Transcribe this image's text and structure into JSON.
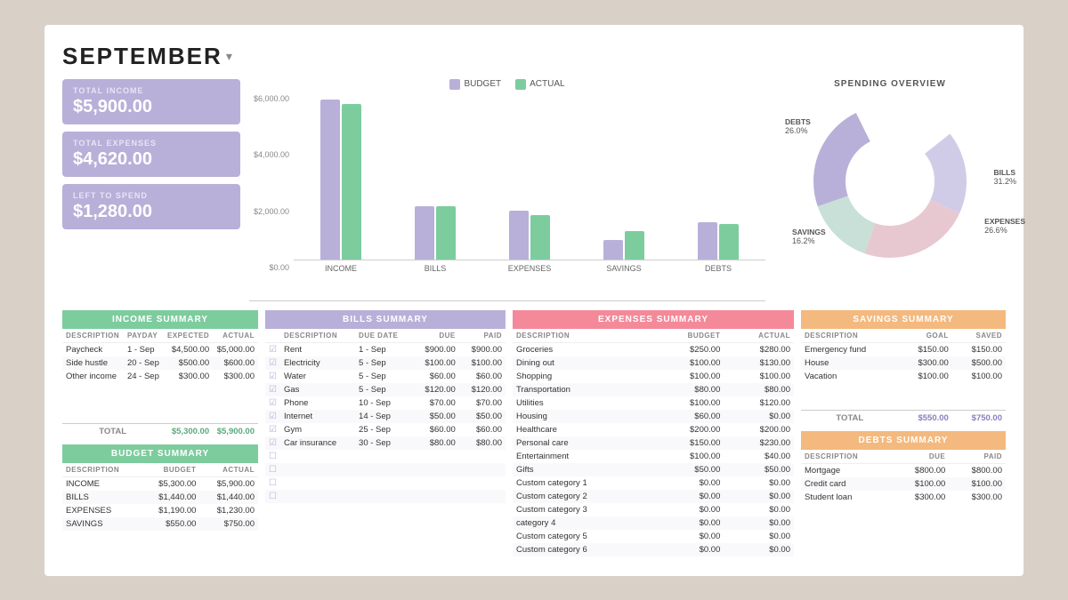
{
  "header": {
    "month": "SEPTEMBER",
    "dropdown": "▾"
  },
  "kpis": [
    {
      "label": "TOTAL INCOME",
      "value": "$5,900.00"
    },
    {
      "label": "TOTAL EXPENSES",
      "value": "$4,620.00"
    },
    {
      "label": "LEFT TO SPEND",
      "value": "$1,280.00"
    }
  ],
  "chart": {
    "legend": [
      "BUDGET",
      "ACTUAL"
    ],
    "yLabels": [
      "$6,000.00",
      "$4,000.00",
      "$2,000.00",
      "$0.00"
    ],
    "groups": [
      {
        "label": "INCOME",
        "budget": 180,
        "actual": 175
      },
      {
        "label": "BILLS",
        "budget": 60,
        "actual": 60
      },
      {
        "label": "EXPENSES",
        "budget": 55,
        "actual": 50
      },
      {
        "label": "SAVINGS",
        "budget": 22,
        "actual": 32
      },
      {
        "label": "DEBTS",
        "budget": 42,
        "actual": 40
      }
    ]
  },
  "donut": {
    "title": "SPENDING OVERVIEW",
    "segments": [
      {
        "label": "BILLS",
        "pct": "31.2%",
        "color": "#d0cce8"
      },
      {
        "label": "EXPENSES",
        "pct": "26.6%",
        "color": "#e8c8d0"
      },
      {
        "label": "SAVINGS",
        "pct": "16.2%",
        "color": "#c8d8e8"
      },
      {
        "label": "DEBTS",
        "pct": "26.0%",
        "color": "#b8b0d8"
      }
    ]
  },
  "income": {
    "header": "INCOME SUMMARY",
    "columns": [
      "DESCRIPTION",
      "PAYDAY",
      "EXPECTED",
      "ACTUAL"
    ],
    "rows": [
      {
        "desc": "Paycheck",
        "payday": "1 - Sep",
        "expected": "$4,500.00",
        "actual": "$5,000.00"
      },
      {
        "desc": "Side hustle",
        "payday": "20 - Sep",
        "expected": "$500.00",
        "actual": "$600.00"
      },
      {
        "desc": "Other income",
        "payday": "24 - Sep",
        "expected": "$300.00",
        "actual": "$300.00"
      }
    ],
    "total": {
      "label": "TOTAL",
      "expected": "$5,300.00",
      "actual": "$5,900.00"
    }
  },
  "budget": {
    "header": "BUDGET SUMMARY",
    "columns": [
      "DESCRIPTION",
      "BUDGET",
      "ACTUAL"
    ],
    "rows": [
      {
        "desc": "INCOME",
        "budget": "$5,300.00",
        "actual": "$5,900.00"
      },
      {
        "desc": "BILLS",
        "budget": "$1,440.00",
        "actual": "$1,440.00"
      },
      {
        "desc": "EXPENSES",
        "budget": "$1,190.00",
        "actual": "$1,230.00"
      },
      {
        "desc": "SAVINGS",
        "budget": "$550.00",
        "actual": "$750.00"
      }
    ]
  },
  "bills": {
    "header": "BILLS SUMMARY",
    "columns": [
      "DESCRIPTION",
      "DUE DATE",
      "DUE",
      "PAID"
    ],
    "rows": [
      {
        "checked": true,
        "desc": "Rent",
        "due_date": "1 - Sep",
        "due": "$900.00",
        "paid": "$900.00"
      },
      {
        "checked": true,
        "desc": "Electricity",
        "due_date": "5 - Sep",
        "due": "$100.00",
        "paid": "$100.00"
      },
      {
        "checked": true,
        "desc": "Water",
        "due_date": "5 - Sep",
        "due": "$60.00",
        "paid": "$60.00"
      },
      {
        "checked": true,
        "desc": "Gas",
        "due_date": "5 - Sep",
        "due": "$120.00",
        "paid": "$120.00"
      },
      {
        "checked": true,
        "desc": "Phone",
        "due_date": "10 - Sep",
        "due": "$70.00",
        "paid": "$70.00"
      },
      {
        "checked": true,
        "desc": "Internet",
        "due_date": "14 - Sep",
        "due": "$50.00",
        "paid": "$50.00"
      },
      {
        "checked": true,
        "desc": "Gym",
        "due_date": "25 - Sep",
        "due": "$60.00",
        "paid": "$60.00"
      },
      {
        "checked": true,
        "desc": "Car insurance",
        "due_date": "30 - Sep",
        "due": "$80.00",
        "paid": "$80.00"
      },
      {
        "checked": false,
        "desc": "",
        "due_date": "",
        "due": "",
        "paid": ""
      },
      {
        "checked": false,
        "desc": "",
        "due_date": "",
        "due": "",
        "paid": ""
      },
      {
        "checked": false,
        "desc": "",
        "due_date": "",
        "due": "",
        "paid": ""
      },
      {
        "checked": false,
        "desc": "",
        "due_date": "",
        "due": "",
        "paid": ""
      }
    ]
  },
  "expenses": {
    "header": "EXPENSES SUMMARY",
    "columns": [
      "DESCRIPTION",
      "BUDGET",
      "ACTUAL"
    ],
    "rows": [
      {
        "desc": "Groceries",
        "budget": "$250.00",
        "actual": "$280.00"
      },
      {
        "desc": "Dining out",
        "budget": "$100.00",
        "actual": "$130.00"
      },
      {
        "desc": "Shopping",
        "budget": "$100.00",
        "actual": "$100.00"
      },
      {
        "desc": "Transportation",
        "budget": "$80.00",
        "actual": "$80.00"
      },
      {
        "desc": "Utilities",
        "budget": "$100.00",
        "actual": "$120.00"
      },
      {
        "desc": "Housing",
        "budget": "$60.00",
        "actual": "$0.00"
      },
      {
        "desc": "Healthcare",
        "budget": "$200.00",
        "actual": "$200.00"
      },
      {
        "desc": "Personal care",
        "budget": "$150.00",
        "actual": "$230.00"
      },
      {
        "desc": "Entertainment",
        "budget": "$100.00",
        "actual": "$40.00"
      },
      {
        "desc": "Gifts",
        "budget": "$50.00",
        "actual": "$50.00"
      },
      {
        "desc": "Custom category 1",
        "budget": "$0.00",
        "actual": "$0.00"
      },
      {
        "desc": "Custom category 2",
        "budget": "$0.00",
        "actual": "$0.00"
      },
      {
        "desc": "Custom category 3",
        "budget": "$0.00",
        "actual": "$0.00"
      },
      {
        "desc": "category 4",
        "budget": "$0.00",
        "actual": "$0.00"
      },
      {
        "desc": "Custom category 5",
        "budget": "$0.00",
        "actual": "$0.00"
      },
      {
        "desc": "Custom category 6",
        "budget": "$0.00",
        "actual": "$0.00"
      }
    ]
  },
  "savings": {
    "header": "SAVINGS SUMMARY",
    "columns": [
      "DESCRIPTION",
      "GOAL",
      "SAVED"
    ],
    "rows": [
      {
        "desc": "Emergency fund",
        "goal": "$150.00",
        "saved": "$150.00"
      },
      {
        "desc": "House",
        "goal": "$300.00",
        "saved": "$500.00"
      },
      {
        "desc": "Vacation",
        "goal": "$100.00",
        "saved": "$100.00"
      }
    ],
    "total": {
      "label": "TOTAL",
      "goal": "$550.00",
      "saved": "$750.00"
    }
  },
  "debts": {
    "header": "DEBTS SUMMARY",
    "columns": [
      "DESCRIPTION",
      "DUE",
      "PAID"
    ],
    "rows": [
      {
        "desc": "Mortgage",
        "due": "$800.00",
        "paid": "$800.00"
      },
      {
        "desc": "Credit card",
        "due": "$100.00",
        "paid": "$100.00"
      },
      {
        "desc": "Student loan",
        "due": "$300.00",
        "paid": "$300.00"
      }
    ]
  }
}
